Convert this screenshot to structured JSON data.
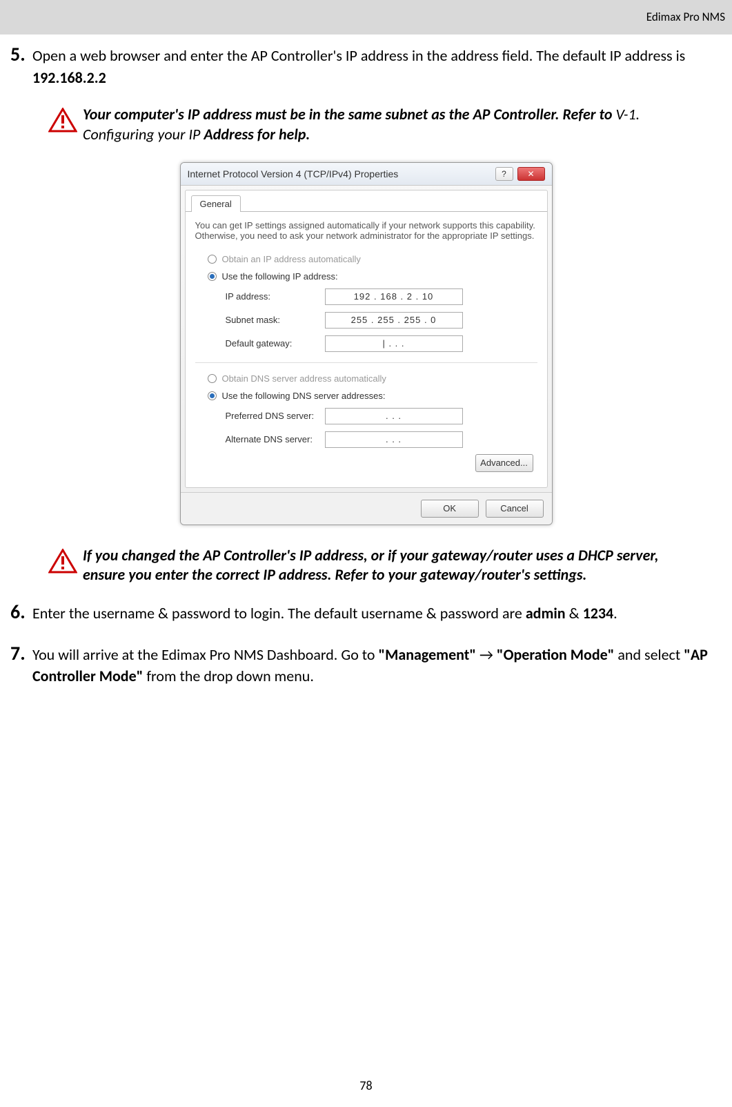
{
  "header": {
    "doc_title": "Edimax Pro NMS"
  },
  "step5": {
    "num": "5.",
    "text_a": "Open a web browser and enter the AP Controller's IP address in the address field. The default IP address is ",
    "ip_bold": "192.168.2.2"
  },
  "note1": {
    "line1_bold": "Your computer's IP address must be in the same subnet as the AP Controller. Refer to ",
    "line1_italic": "V-1. Configuring your IP ",
    "line1_bold2": "Address for help."
  },
  "dialog": {
    "title": "Internet Protocol Version 4 (TCP/IPv4) Properties",
    "help_q": "?",
    "close_x": "✕",
    "tab_general": "General",
    "desc": "You can get IP settings assigned automatically if your network supports this capability. Otherwise, you need to ask your network administrator for the appropriate IP settings.",
    "opt_auto_ip": "Obtain an IP address automatically",
    "opt_use_ip": "Use the following IP address:",
    "lbl_ip": "IP address:",
    "val_ip": "192 . 168 .  2   . 10",
    "lbl_subnet": "Subnet mask:",
    "val_subnet": "255 . 255 . 255 .  0",
    "lbl_gateway": "Default gateway:",
    "val_gateway": "|       .         .         .",
    "opt_auto_dns": "Obtain DNS server address automatically",
    "opt_use_dns": "Use the following DNS server addresses:",
    "lbl_dns1": "Preferred DNS server:",
    "val_dns1": ".         .         .",
    "lbl_dns2": "Alternate DNS server:",
    "val_dns2": ".         .         .",
    "btn_adv": "Advanced...",
    "btn_ok": "OK",
    "btn_cancel": "Cancel"
  },
  "note2": {
    "text": "If you changed the AP Controller's IP address, or if your gateway/router uses a DHCP server, ensure you enter the correct IP address. Refer to your gateway/router's settings."
  },
  "step6": {
    "num": "6.",
    "text_a": "Enter the username & password to login. The default username & password are ",
    "b1": "admin",
    "amp": " & ",
    "b2": "1234",
    "period": "."
  },
  "step7": {
    "num": "7.",
    "text_a": "You will arrive at the Edimax Pro NMS Dashboard. Go to ",
    "b1": "\"Management\"",
    "arrow": " → ",
    "b2": "\"Operation Mode\"",
    "mid": " and select ",
    "b3": "\"AP Controller Mode\"",
    "end": " from the drop down menu."
  },
  "page_number": "78"
}
